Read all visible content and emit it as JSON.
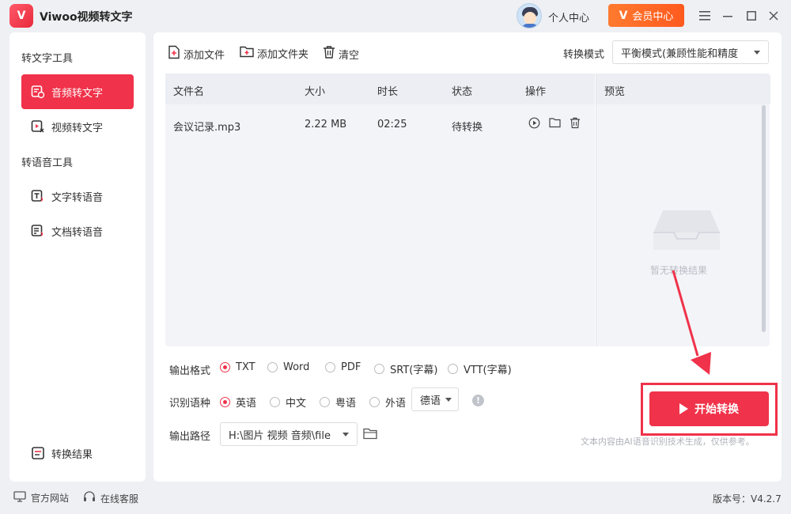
{
  "app": {
    "logo_text": "V",
    "title": "Viwoo视频转文字"
  },
  "header": {
    "personal_center": "个人中心",
    "vip_label": "会员中心",
    "vip_icon": "V"
  },
  "sidebar": {
    "section1": "转文字工具",
    "items1": [
      {
        "label": "音频转文字",
        "active": true
      },
      {
        "label": "视频转文字",
        "active": false
      }
    ],
    "section2": "转语音工具",
    "items2": [
      {
        "label": "文字转语音"
      },
      {
        "label": "文档转语音"
      }
    ],
    "result": "转换结果"
  },
  "toolbar": {
    "add_file": "添加文件",
    "add_folder": "添加文件夹",
    "clear": "清空",
    "mode_label": "转换模式",
    "mode_value": "平衡模式(兼顾性能和精度"
  },
  "table": {
    "headers": [
      "文件名",
      "大小",
      "时长",
      "状态",
      "操作"
    ],
    "rows": [
      {
        "name": "会议记录.mp3",
        "size": "2.22 MB",
        "duration": "02:25",
        "status": "待转换"
      }
    ]
  },
  "preview": {
    "title": "预览",
    "empty_text": "暂无转换结果"
  },
  "options": {
    "format_label": "输出格式",
    "formats": [
      "TXT",
      "Word",
      "PDF",
      "SRT(字幕)",
      "VTT(字幕)"
    ],
    "format_selected": "TXT",
    "lang_label": "识别语种",
    "langs": [
      "英语",
      "中文",
      "粤语",
      "外语"
    ],
    "lang_selected": "英语",
    "foreign_value": "德语",
    "info_icon": "!",
    "path_label": "输出路径",
    "path_value": "H:\\图片 视频 音频\\file"
  },
  "start_button": "开始转换",
  "disclaimer": "文本内容由AI语音识别技术生成，仅供参考。",
  "footer": {
    "website": "官方网站",
    "service": "在线客服",
    "version": "版本号：V4.2.7"
  },
  "colors": {
    "accent": "#f0324a",
    "vip": "#ff6a26"
  }
}
